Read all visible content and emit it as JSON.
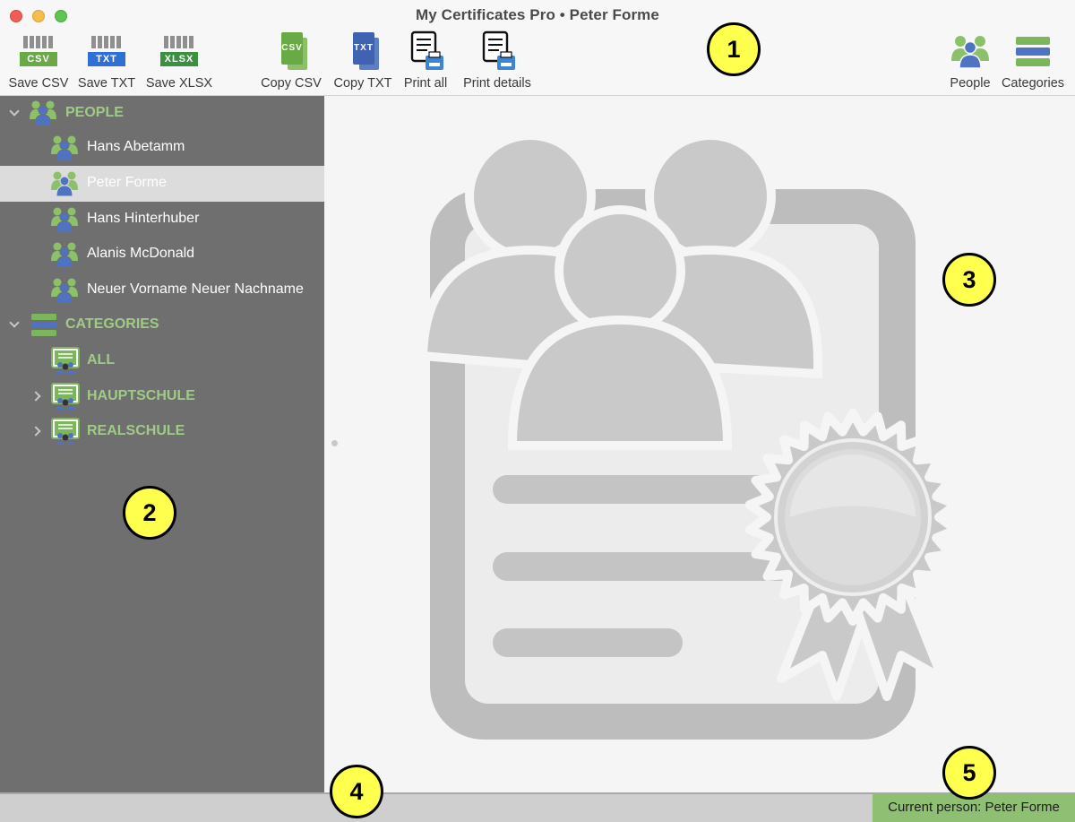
{
  "window": {
    "title": "My Certificates Pro • Peter Forme"
  },
  "toolbar": {
    "save_csv": {
      "label": "Save CSV",
      "tag": "CSV",
      "tag_color": "#6aaa46"
    },
    "save_txt": {
      "label": "Save TXT",
      "tag": "TXT",
      "tag_color": "#2f6fd6"
    },
    "save_xlsx": {
      "label": "Save XLSX",
      "tag": "XLSX",
      "tag_color": "#3b8f40"
    },
    "copy_csv": {
      "label": "Copy CSV",
      "tag": "CSV"
    },
    "copy_txt": {
      "label": "Copy TXT",
      "tag": "TXT"
    },
    "print_all": {
      "label": "Print all"
    },
    "print_details": {
      "label": "Print details"
    },
    "people": {
      "label": "People"
    },
    "categories": {
      "label": "Categories"
    }
  },
  "sidebar": {
    "people_header": "PEOPLE",
    "people": [
      {
        "name": "Hans Abetamm",
        "selected": false
      },
      {
        "name": "Peter Forme",
        "selected": true
      },
      {
        "name": "Hans Hinterhuber",
        "selected": false
      },
      {
        "name": "Alanis McDonald",
        "selected": false
      },
      {
        "name": "Neuer Vorname Neuer Nachname",
        "selected": false
      }
    ],
    "categories_header": "CATEGORIES",
    "categories": [
      {
        "name": "ALL",
        "expandable": false
      },
      {
        "name": "HAUPTSCHULE",
        "expandable": true
      },
      {
        "name": "REALSCHULE",
        "expandable": true
      }
    ]
  },
  "status_bar": {
    "text": "Current person: Peter Forme"
  },
  "callouts": [
    "1",
    "2",
    "3",
    "4",
    "5"
  ],
  "colors": {
    "accent_green": "#9fcb86",
    "sidebar_bg": "#6f6f6f",
    "status_bg": "#8fbf73",
    "callout_bg": "#ffff4d"
  }
}
